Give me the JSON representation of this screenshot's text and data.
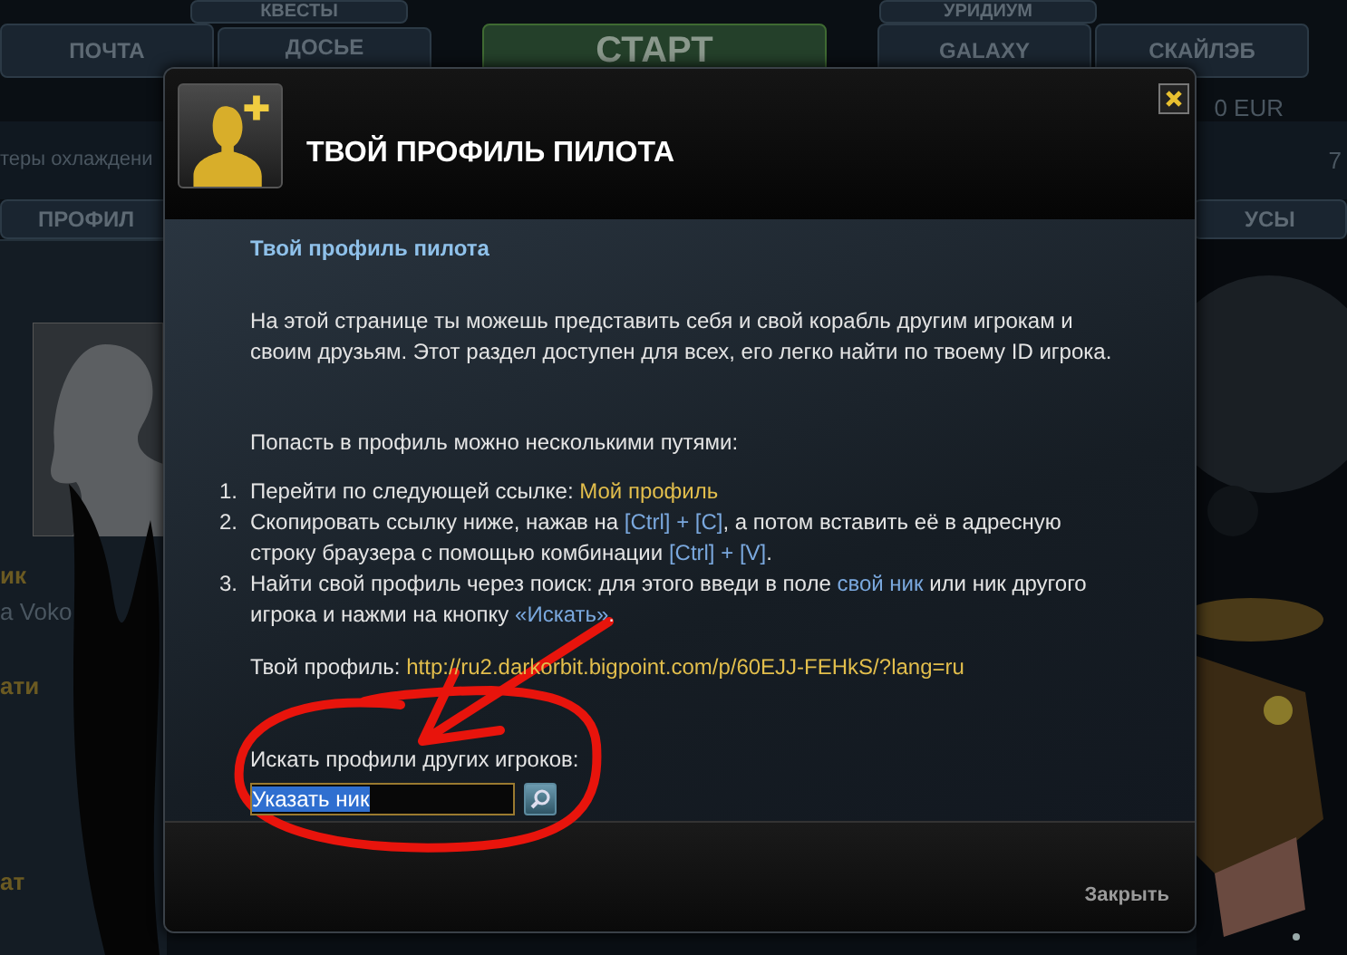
{
  "background": {
    "upper_tabs": [
      {
        "label": "КВЕСТЫ"
      },
      {
        "label": "УРИДИУМ"
      }
    ],
    "lower_tabs": [
      {
        "label": "ПОЧТА",
        "kind": "tab"
      },
      {
        "label": "ДОСЬЕ",
        "kind": "tab"
      },
      {
        "label": "СТАРТ",
        "kind": "start"
      },
      {
        "label": "GALAXY",
        "kind": "tab"
      },
      {
        "label": "СКАЙЛЭБ",
        "kind": "tab"
      }
    ],
    "balance": "0 EUR",
    "info_text": "теры охлаждени",
    "info_value": "7",
    "left_tab": "ПРОФИЛ",
    "right_tab": "УСЫ",
    "pilot_label": "ик",
    "pilot_name": "а Voko",
    "stats_heading": "ати",
    "stats_heading_2": "ат"
  },
  "dialog": {
    "title": "ТВОЙ ПРОФИЛЬ ПИЛОТА",
    "heading": "Твой профиль пилота",
    "intro": "На этой странице ты можешь представить себя и свой корабль другим игрокам и своим друзьям. Этот раздел доступен для всех, его легко найти по твоему ID игрока.",
    "ways_title": "Попасть в профиль можно несколькими путями:",
    "steps": [
      {
        "number": "1.",
        "parts": [
          {
            "text": "Перейти по следующей ссылке: ",
            "kind": "plain"
          },
          {
            "text": "Мой профиль",
            "kind": "link"
          }
        ]
      },
      {
        "number": "2.",
        "parts": [
          {
            "text": "Скопировать ссылку ниже, нажав на ",
            "kind": "plain"
          },
          {
            "text": "[Ctrl] + [C]",
            "kind": "key"
          },
          {
            "text": ", а потом вставить её в адресную строку браузера с помощью комбинации ",
            "kind": "plain"
          },
          {
            "text": "[Ctrl] + [V]",
            "kind": "key"
          },
          {
            "text": ".",
            "kind": "plain"
          }
        ]
      },
      {
        "number": "3.",
        "parts": [
          {
            "text": "Найти свой профиль через поиск: для этого введи в поле ",
            "kind": "plain"
          },
          {
            "text": "свой ник",
            "kind": "key"
          },
          {
            "text": " или ник другого игрока и нажми на кнопку ",
            "kind": "plain"
          },
          {
            "text": "«Искать»",
            "kind": "key"
          },
          {
            "text": ".",
            "kind": "plain"
          }
        ]
      }
    ],
    "profile_label": "Твой профиль:",
    "profile_url": "http://ru2.darkorbit.bigpoint.com/p/60EJJ-FEHkS/?lang=ru",
    "search_label": "Искать профили других игроков:",
    "search_field": {
      "value": "Указать ник",
      "text_selected": true
    },
    "close": "Закрыть"
  }
}
